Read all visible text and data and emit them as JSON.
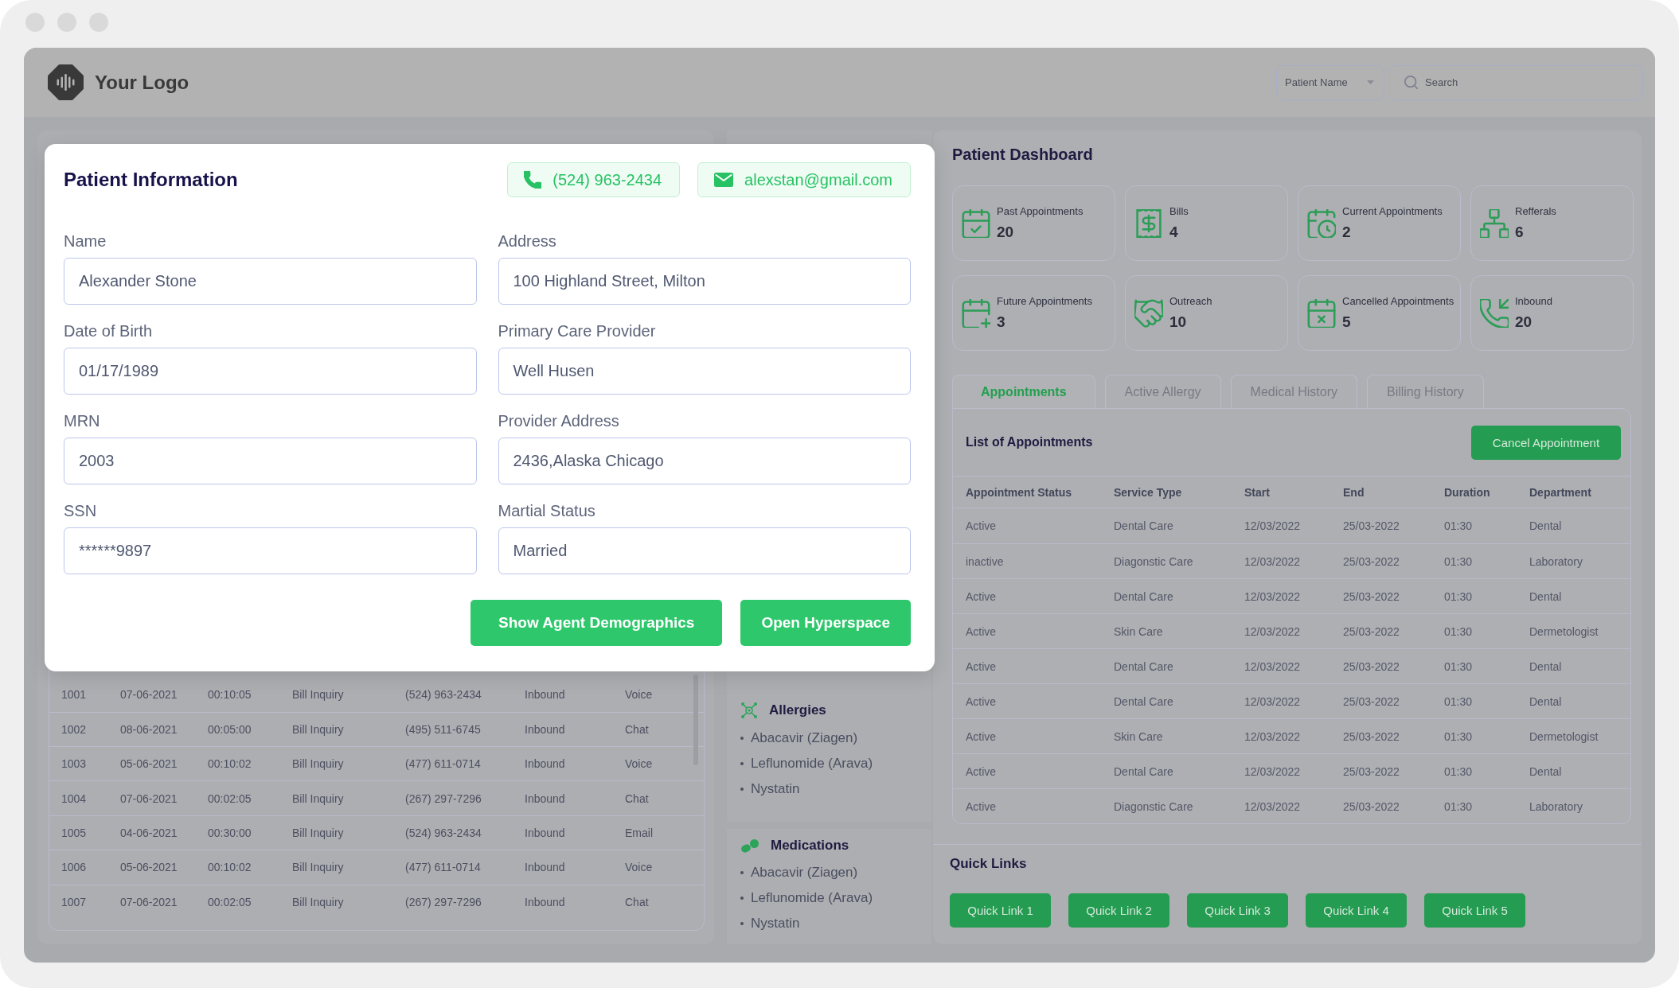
{
  "header": {
    "logo_text": "Your Logo",
    "filter": {
      "value": "Patient Name"
    },
    "search": {
      "placeholder": "Search"
    }
  },
  "patient_modal": {
    "title": "Patient Information",
    "phone": "(524) 963-2434",
    "email": "alexstan@gmail.com",
    "fields": [
      {
        "label": "Name",
        "value": "Alexander Stone"
      },
      {
        "label": "Address",
        "value": "100 Highland Street, Milton"
      },
      {
        "label": "Date of Birth",
        "value": "01/17/1989"
      },
      {
        "label": "Primary Care Provider",
        "value": "Well Husen"
      },
      {
        "label": "MRN",
        "value": "2003"
      },
      {
        "label": "Provider Address",
        "value": "2436,Alaska Chicago"
      },
      {
        "label": "SSN",
        "value": "******9897"
      },
      {
        "label": "Martial Status",
        "value": "Married"
      }
    ],
    "buttons": [
      "Show Agent Demographics",
      "Open Hyperspace"
    ]
  },
  "calls_table": {
    "rows": [
      [
        "1001",
        "07-06-2021",
        "00:10:05",
        "Bill Inquiry",
        "(524) 963-2434",
        "Inbound",
        "Voice"
      ],
      [
        "1002",
        "08-06-2021",
        "00:05:00",
        "Bill Inquiry",
        "(495) 511-6745",
        "Inbound",
        "Chat"
      ],
      [
        "1003",
        "05-06-2021",
        "00:10:02",
        "Bill Inquiry",
        "(477) 611-0714",
        "Inbound",
        "Voice"
      ],
      [
        "1004",
        "07-06-2021",
        "00:02:05",
        "Bill Inquiry",
        "(267) 297-7296",
        "Inbound",
        "Chat"
      ],
      [
        "1005",
        "04-06-2021",
        "00:30:00",
        "Bill Inquiry",
        "(524) 963-2434",
        "Inbound",
        "Email"
      ],
      [
        "1006",
        "05-06-2021",
        "00:10:02",
        "Bill Inquiry",
        "(477) 611-0714",
        "Inbound",
        "Voice"
      ],
      [
        "1007",
        "07-06-2021",
        "00:02:05",
        "Bill Inquiry",
        "(267) 297-7296",
        "Inbound",
        "Chat"
      ]
    ]
  },
  "allergies": {
    "title": "Allergies",
    "items": [
      "Abacavir (Ziagen)",
      "Leflunomide (Arava)",
      "Nystatin"
    ]
  },
  "medications": {
    "title": "Medications",
    "items": [
      "Abacavir (Ziagen)",
      "Leflunomide (Arava)",
      "Nystatin"
    ]
  },
  "dashboard": {
    "title": "Patient Dashboard",
    "stats": [
      {
        "label": "Past Appointments",
        "value": "20"
      },
      {
        "label": "Bills",
        "value": "4"
      },
      {
        "label": "Current Appointments",
        "value": "2"
      },
      {
        "label": "Refferals",
        "value": "6"
      },
      {
        "label": "Future Appointments",
        "value": "3"
      },
      {
        "label": "Outreach",
        "value": "10"
      },
      {
        "label": "Cancelled Appointments",
        "value": "5"
      },
      {
        "label": "Inbound",
        "value": "20"
      }
    ],
    "tabs": [
      {
        "label": "Appointments",
        "selected": true
      },
      {
        "label": "Active Allergy",
        "selected": false
      },
      {
        "label": "Medical History",
        "selected": false
      },
      {
        "label": "Billing History",
        "selected": false
      }
    ],
    "appointments": {
      "title": "List of Appointments",
      "action": "Cancel Appointment",
      "columns": [
        "Appointment Status",
        "Service Type",
        "Start",
        "End",
        "Duration",
        "Department"
      ],
      "rows": [
        [
          "Active",
          "Dental Care",
          "12/03/2022",
          "25/03-2022",
          "01:30",
          "Dental"
        ],
        [
          "inactive",
          "Diagonstic Care",
          "12/03/2022",
          "25/03-2022",
          "01:30",
          "Laboratory"
        ],
        [
          "Active",
          "Dental Care",
          "12/03/2022",
          "25/03-2022",
          "01:30",
          "Dental"
        ],
        [
          "Active",
          "Skin Care",
          "12/03/2022",
          "25/03-2022",
          "01:30",
          "Dermetologist"
        ],
        [
          "Active",
          "Dental Care",
          "12/03/2022",
          "25/03-2022",
          "01:30",
          "Dental"
        ],
        [
          "Active",
          "Dental Care",
          "12/03/2022",
          "25/03-2022",
          "01:30",
          "Dental"
        ],
        [
          "Active",
          "Skin Care",
          "12/03/2022",
          "25/03-2022",
          "01:30",
          "Dermetologist"
        ],
        [
          "Active",
          "Dental Care",
          "12/03/2022",
          "25/03-2022",
          "01:30",
          "Dental"
        ],
        [
          "Active",
          "Diagonstic Care",
          "12/03/2022",
          "25/03-2022",
          "01:30",
          "Laboratory"
        ]
      ]
    }
  },
  "quick_links": {
    "title": "Quick Links",
    "links": [
      "Quick Link 1",
      "Quick Link 2",
      "Quick Link 3",
      "Quick Link 4",
      "Quick Link 5"
    ]
  }
}
